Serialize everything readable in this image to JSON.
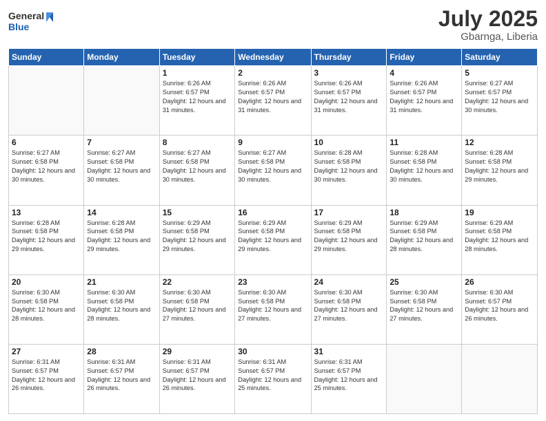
{
  "header": {
    "logo_general": "General",
    "logo_blue": "Blue",
    "title": "July 2025",
    "location": "Gbarnga, Liberia"
  },
  "weekdays": [
    "Sunday",
    "Monday",
    "Tuesday",
    "Wednesday",
    "Thursday",
    "Friday",
    "Saturday"
  ],
  "weeks": [
    [
      {
        "day": "",
        "info": ""
      },
      {
        "day": "",
        "info": ""
      },
      {
        "day": "1",
        "info": "Sunrise: 6:26 AM\nSunset: 6:57 PM\nDaylight: 12 hours and 31 minutes."
      },
      {
        "day": "2",
        "info": "Sunrise: 6:26 AM\nSunset: 6:57 PM\nDaylight: 12 hours and 31 minutes."
      },
      {
        "day": "3",
        "info": "Sunrise: 6:26 AM\nSunset: 6:57 PM\nDaylight: 12 hours and 31 minutes."
      },
      {
        "day": "4",
        "info": "Sunrise: 6:26 AM\nSunset: 6:57 PM\nDaylight: 12 hours and 31 minutes."
      },
      {
        "day": "5",
        "info": "Sunrise: 6:27 AM\nSunset: 6:57 PM\nDaylight: 12 hours and 30 minutes."
      }
    ],
    [
      {
        "day": "6",
        "info": "Sunrise: 6:27 AM\nSunset: 6:58 PM\nDaylight: 12 hours and 30 minutes."
      },
      {
        "day": "7",
        "info": "Sunrise: 6:27 AM\nSunset: 6:58 PM\nDaylight: 12 hours and 30 minutes."
      },
      {
        "day": "8",
        "info": "Sunrise: 6:27 AM\nSunset: 6:58 PM\nDaylight: 12 hours and 30 minutes."
      },
      {
        "day": "9",
        "info": "Sunrise: 6:27 AM\nSunset: 6:58 PM\nDaylight: 12 hours and 30 minutes."
      },
      {
        "day": "10",
        "info": "Sunrise: 6:28 AM\nSunset: 6:58 PM\nDaylight: 12 hours and 30 minutes."
      },
      {
        "day": "11",
        "info": "Sunrise: 6:28 AM\nSunset: 6:58 PM\nDaylight: 12 hours and 30 minutes."
      },
      {
        "day": "12",
        "info": "Sunrise: 6:28 AM\nSunset: 6:58 PM\nDaylight: 12 hours and 29 minutes."
      }
    ],
    [
      {
        "day": "13",
        "info": "Sunrise: 6:28 AM\nSunset: 6:58 PM\nDaylight: 12 hours and 29 minutes."
      },
      {
        "day": "14",
        "info": "Sunrise: 6:28 AM\nSunset: 6:58 PM\nDaylight: 12 hours and 29 minutes."
      },
      {
        "day": "15",
        "info": "Sunrise: 6:29 AM\nSunset: 6:58 PM\nDaylight: 12 hours and 29 minutes."
      },
      {
        "day": "16",
        "info": "Sunrise: 6:29 AM\nSunset: 6:58 PM\nDaylight: 12 hours and 29 minutes."
      },
      {
        "day": "17",
        "info": "Sunrise: 6:29 AM\nSunset: 6:58 PM\nDaylight: 12 hours and 29 minutes."
      },
      {
        "day": "18",
        "info": "Sunrise: 6:29 AM\nSunset: 6:58 PM\nDaylight: 12 hours and 28 minutes."
      },
      {
        "day": "19",
        "info": "Sunrise: 6:29 AM\nSunset: 6:58 PM\nDaylight: 12 hours and 28 minutes."
      }
    ],
    [
      {
        "day": "20",
        "info": "Sunrise: 6:30 AM\nSunset: 6:58 PM\nDaylight: 12 hours and 28 minutes."
      },
      {
        "day": "21",
        "info": "Sunrise: 6:30 AM\nSunset: 6:58 PM\nDaylight: 12 hours and 28 minutes."
      },
      {
        "day": "22",
        "info": "Sunrise: 6:30 AM\nSunset: 6:58 PM\nDaylight: 12 hours and 27 minutes."
      },
      {
        "day": "23",
        "info": "Sunrise: 6:30 AM\nSunset: 6:58 PM\nDaylight: 12 hours and 27 minutes."
      },
      {
        "day": "24",
        "info": "Sunrise: 6:30 AM\nSunset: 6:58 PM\nDaylight: 12 hours and 27 minutes."
      },
      {
        "day": "25",
        "info": "Sunrise: 6:30 AM\nSunset: 6:58 PM\nDaylight: 12 hours and 27 minutes."
      },
      {
        "day": "26",
        "info": "Sunrise: 6:30 AM\nSunset: 6:57 PM\nDaylight: 12 hours and 26 minutes."
      }
    ],
    [
      {
        "day": "27",
        "info": "Sunrise: 6:31 AM\nSunset: 6:57 PM\nDaylight: 12 hours and 26 minutes."
      },
      {
        "day": "28",
        "info": "Sunrise: 6:31 AM\nSunset: 6:57 PM\nDaylight: 12 hours and 26 minutes."
      },
      {
        "day": "29",
        "info": "Sunrise: 6:31 AM\nSunset: 6:57 PM\nDaylight: 12 hours and 26 minutes."
      },
      {
        "day": "30",
        "info": "Sunrise: 6:31 AM\nSunset: 6:57 PM\nDaylight: 12 hours and 25 minutes."
      },
      {
        "day": "31",
        "info": "Sunrise: 6:31 AM\nSunset: 6:57 PM\nDaylight: 12 hours and 25 minutes."
      },
      {
        "day": "",
        "info": ""
      },
      {
        "day": "",
        "info": ""
      }
    ]
  ]
}
